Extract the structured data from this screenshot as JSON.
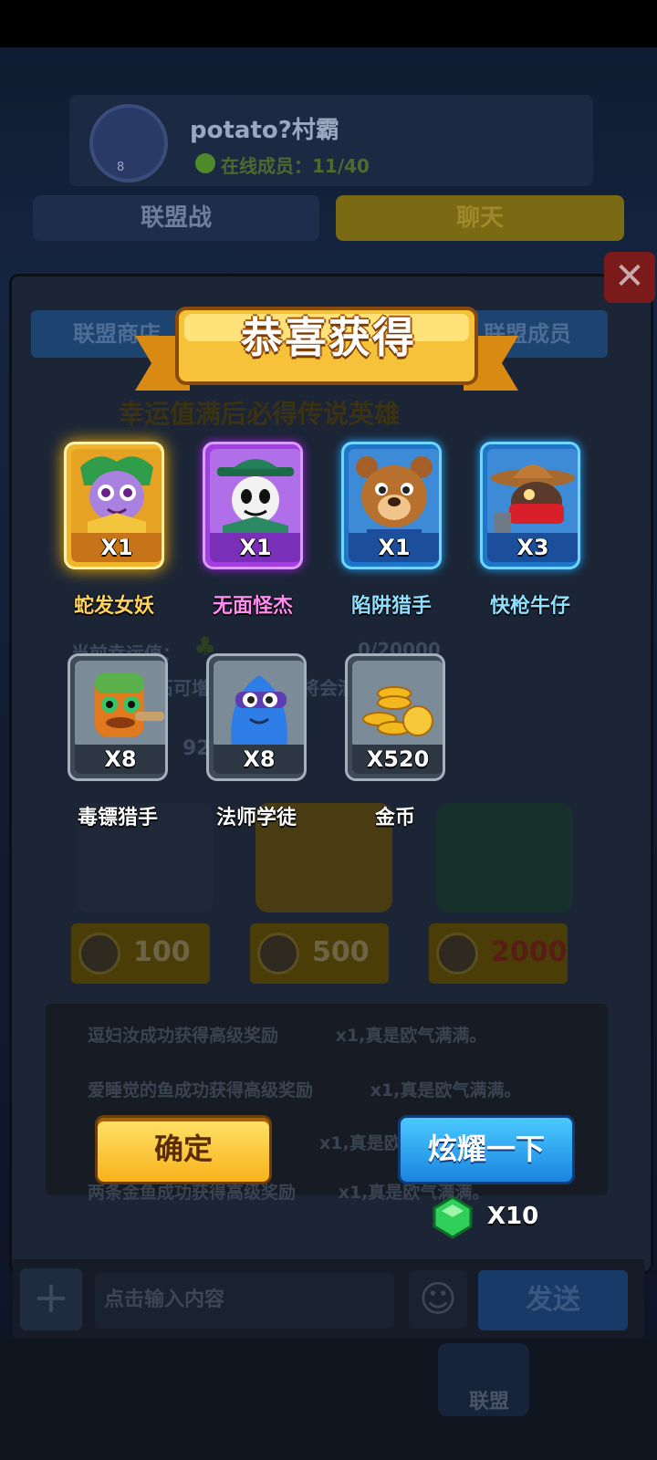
{
  "background": {
    "guild": {
      "name": "potato?村霸",
      "level": "8",
      "online": "在线成员：11/40"
    },
    "top_tabs": {
      "war": "联盟战",
      "chat": "聊天"
    },
    "panel_tabs": {
      "left": "联盟商店",
      "right": "联盟成员"
    },
    "hint": "幸运值满后必得传说英雄",
    "luck": {
      "label": "当前幸运值：",
      "value": "0/20000"
    },
    "rule": "钻石可增加幸运值，将会清空幸运值",
    "partial_value": "92",
    "chest_prices": [
      "100",
      "500",
      "2000"
    ],
    "feed": [
      {
        "text": "逗妇汝成功获得高级奖励",
        "suffix": "x1,真是欧气满满。"
      },
      {
        "text": "爱睡觉的鱼成功获得高级奖励",
        "suffix": "x1,真是欧气满满。"
      },
      {
        "text": "",
        "suffix": "x1,真是欧"
      },
      {
        "text": "两条金鱼成功获得高级奖励",
        "suffix": "x1,真是欧气满满。"
      }
    ],
    "chat_input_placeholder": "点击输入内容",
    "send_label": "发送",
    "nav_active_label": "联盟"
  },
  "dialog": {
    "title": "恭喜获得",
    "rewards": [
      {
        "name": "蛇发女妖",
        "qty": "X1",
        "rarity": "gold",
        "color": "#f0b52a"
      },
      {
        "name": "无面怪杰",
        "qty": "X1",
        "rarity": "purple",
        "color": "#a53ee0"
      },
      {
        "name": "陷阱猎手",
        "qty": "X1",
        "rarity": "blue",
        "color": "#1d76c9"
      },
      {
        "name": "快枪牛仔",
        "qty": "X3",
        "rarity": "blue",
        "color": "#1d76c9"
      },
      {
        "name": "毒镖猎手",
        "qty": "X8",
        "rarity": "gray",
        "color": "#3f4a57"
      },
      {
        "name": "法师学徒",
        "qty": "X8",
        "rarity": "gray",
        "color": "#3f4a57"
      },
      {
        "name": "金币",
        "qty": "X520",
        "rarity": "gray",
        "color": "#3f4a57"
      }
    ],
    "confirm_label": "确定",
    "share_label": "炫耀一下",
    "share_cost": "X10",
    "share_cost_icon": "gem-icon"
  }
}
